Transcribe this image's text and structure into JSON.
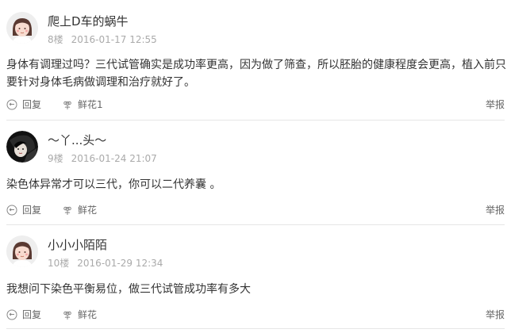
{
  "comments": [
    {
      "username": "爬上D车的蜗牛",
      "floor": "8楼",
      "time": "2016-01-17 12:55",
      "avatar": "default-girl-avatar",
      "content": "身体有调理过吗？三代试管确实是成功率更高，因为做了筛查，所以胚胎的健康程度会更高，植入前只要针对身体毛病做调理和治疗就好了。",
      "reply_label": "回复",
      "flower_label": "鲜花1",
      "report_label": "举报"
    },
    {
      "username": "～丫...头～",
      "floor": "9楼",
      "time": "2016-01-24 21:07",
      "avatar": "photo-avatar",
      "content": "染色体异常才可以三代，你可以二代养囊 。",
      "reply_label": "回复",
      "flower_label": "鲜花",
      "report_label": "举报"
    },
    {
      "username": "小小小陌陌",
      "floor": "10楼",
      "time": "2016-01-29 12:34",
      "avatar": "default-girl-avatar",
      "content": "我想问下染色平衡易位，做三代试管成功率有多大",
      "reply_label": "回复",
      "flower_label": "鲜花",
      "report_label": "举报"
    }
  ],
  "colors": {
    "text": "#333333",
    "meta": "#aaaaaa",
    "action": "#666666",
    "divider": "#e6e6e6",
    "avatar_skin": "#f8dcd0",
    "avatar_hair": "#5a3a32",
    "avatar_cheek": "#f4a6a6"
  },
  "icons": {
    "reply": "reply-icon",
    "flower": "flower-icon"
  }
}
